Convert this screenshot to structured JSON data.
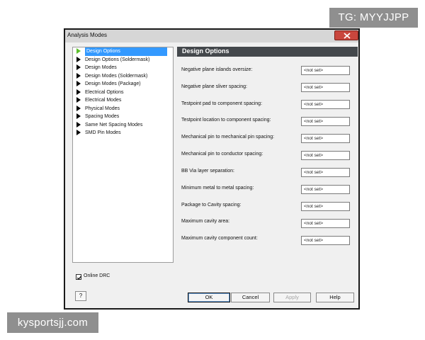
{
  "watermarks": {
    "top": "TG: MYYJJPP",
    "bottom": "kysportsjj.com"
  },
  "window": {
    "title": "Analysis Modes",
    "close_icon": "close-x-icon"
  },
  "tree": {
    "items": [
      {
        "label": "Design Options",
        "selected": true
      },
      {
        "label": "Design Options (Soldermask)"
      },
      {
        "label": "Design Modes"
      },
      {
        "label": "Design Modes (Soldermask)"
      },
      {
        "label": "Design Modes (Package)"
      },
      {
        "label": "Electrical Options"
      },
      {
        "label": "Electrical Modes"
      },
      {
        "label": "Physical Modes"
      },
      {
        "label": "Spacing Modes"
      },
      {
        "label": "Same Net Spacing Modes"
      },
      {
        "label": "SMD Pin Modes"
      }
    ]
  },
  "panel": {
    "header": "Design Options",
    "fields": [
      {
        "label": "Negative plane islands oversize:",
        "value": "<not set>"
      },
      {
        "label": "Negative plane sliver spacing:",
        "value": "<not set>"
      },
      {
        "label": "Testpoint pad to component spacing:",
        "value": "<not set>"
      },
      {
        "label": "Testpoint location to component spacing:",
        "value": "<not set>"
      },
      {
        "label": "Mechanical pin to mechanical pin spacing:",
        "value": "<not set>"
      },
      {
        "label": "Mechanical pin to conductor spacing:",
        "value": "<not set>"
      },
      {
        "label": "BB Via layer separation:",
        "value": "<not set>"
      },
      {
        "label": "Minimum metal to metal spacing:",
        "value": "<not set>"
      },
      {
        "label": "Package to Cavity spacing:",
        "value": "<not set>"
      },
      {
        "label": "Maximum cavity area:",
        "value": "<not set>"
      },
      {
        "label": "Maximum cavity component count:",
        "value": "<not set>"
      }
    ]
  },
  "online_drc": {
    "label": "Online DRC",
    "checked": true
  },
  "buttons": {
    "help_q": "?",
    "ok": "OK",
    "cancel": "Cancel",
    "apply": "Apply",
    "help": "Help"
  }
}
